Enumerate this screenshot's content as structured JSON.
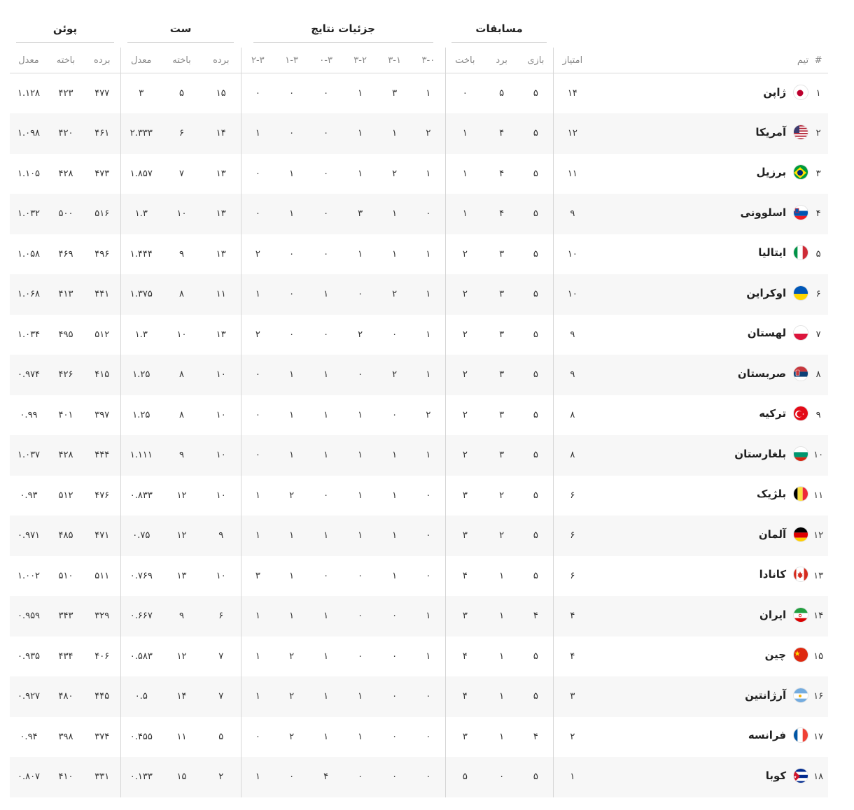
{
  "header": {
    "groups": {
      "matches": "مسابقات",
      "details": "جزئیات نتایج",
      "sets": "ست",
      "points": "پوئن"
    },
    "columns": {
      "rank": "#",
      "team": "تیم",
      "score": "امتیاز",
      "played": "بازی",
      "won": "برد",
      "lost": "باخت",
      "r30": "۳-۰",
      "r31": "۳-۱",
      "r32": "۳-۲",
      "r03": "۰-۳",
      "r13": "۱-۳",
      "r23": "۲-۳",
      "sets_won": "برده",
      "sets_lost": "باخته",
      "sets_ratio": "معدل",
      "pts_won": "برده",
      "pts_lost": "باخته",
      "pts_ratio": "معدل"
    }
  },
  "rows": [
    {
      "rank": "۱",
      "team": "ژاپن",
      "flag": "japan-flag-icon",
      "score": "۱۴",
      "played": "۵",
      "won": "۵",
      "lost": "۰",
      "r30": "۱",
      "r31": "۳",
      "r32": "۱",
      "r03": "۰",
      "r13": "۰",
      "r23": "۰",
      "sets_won": "۱۵",
      "sets_lost": "۵",
      "sets_ratio": "۳",
      "pts_won": "۴۷۷",
      "pts_lost": "۴۲۳",
      "pts_ratio": "۱.۱۲۸"
    },
    {
      "rank": "۲",
      "team": "آمریکا",
      "flag": "usa-flag-icon",
      "score": "۱۲",
      "played": "۵",
      "won": "۴",
      "lost": "۱",
      "r30": "۲",
      "r31": "۱",
      "r32": "۱",
      "r03": "۰",
      "r13": "۰",
      "r23": "۱",
      "sets_won": "۱۴",
      "sets_lost": "۶",
      "sets_ratio": "۲.۳۳۳",
      "pts_won": "۴۶۱",
      "pts_lost": "۴۲۰",
      "pts_ratio": "۱.۰۹۸"
    },
    {
      "rank": "۳",
      "team": "برزیل",
      "flag": "brazil-flag-icon",
      "score": "۱۱",
      "played": "۵",
      "won": "۴",
      "lost": "۱",
      "r30": "۱",
      "r31": "۲",
      "r32": "۱",
      "r03": "۰",
      "r13": "۱",
      "r23": "۰",
      "sets_won": "۱۳",
      "sets_lost": "۷",
      "sets_ratio": "۱.۸۵۷",
      "pts_won": "۴۷۳",
      "pts_lost": "۴۲۸",
      "pts_ratio": "۱.۱۰۵"
    },
    {
      "rank": "۴",
      "team": "اسلوونی",
      "flag": "slovenia-flag-icon",
      "score": "۹",
      "played": "۵",
      "won": "۴",
      "lost": "۱",
      "r30": "۰",
      "r31": "۱",
      "r32": "۳",
      "r03": "۰",
      "r13": "۱",
      "r23": "۰",
      "sets_won": "۱۳",
      "sets_lost": "۱۰",
      "sets_ratio": "۱.۳",
      "pts_won": "۵۱۶",
      "pts_lost": "۵۰۰",
      "pts_ratio": "۱.۰۳۲"
    },
    {
      "rank": "۵",
      "team": "ایتالیا",
      "flag": "italy-flag-icon",
      "score": "۱۰",
      "played": "۵",
      "won": "۳",
      "lost": "۲",
      "r30": "۱",
      "r31": "۱",
      "r32": "۱",
      "r03": "۰",
      "r13": "۰",
      "r23": "۲",
      "sets_won": "۱۳",
      "sets_lost": "۹",
      "sets_ratio": "۱.۴۴۴",
      "pts_won": "۴۹۶",
      "pts_lost": "۴۶۹",
      "pts_ratio": "۱.۰۵۸"
    },
    {
      "rank": "۶",
      "team": "اوکراین",
      "flag": "ukraine-flag-icon",
      "score": "۱۰",
      "played": "۵",
      "won": "۳",
      "lost": "۲",
      "r30": "۱",
      "r31": "۲",
      "r32": "۰",
      "r03": "۱",
      "r13": "۰",
      "r23": "۱",
      "sets_won": "۱۱",
      "sets_lost": "۸",
      "sets_ratio": "۱.۳۷۵",
      "pts_won": "۴۴۱",
      "pts_lost": "۴۱۳",
      "pts_ratio": "۱.۰۶۸"
    },
    {
      "rank": "۷",
      "team": "لهستان",
      "flag": "poland-flag-icon",
      "score": "۹",
      "played": "۵",
      "won": "۳",
      "lost": "۲",
      "r30": "۱",
      "r31": "۰",
      "r32": "۲",
      "r03": "۰",
      "r13": "۰",
      "r23": "۲",
      "sets_won": "۱۳",
      "sets_lost": "۱۰",
      "sets_ratio": "۱.۳",
      "pts_won": "۵۱۲",
      "pts_lost": "۴۹۵",
      "pts_ratio": "۱.۰۳۴"
    },
    {
      "rank": "۸",
      "team": "صربستان",
      "flag": "serbia-flag-icon",
      "score": "۹",
      "played": "۵",
      "won": "۳",
      "lost": "۲",
      "r30": "۱",
      "r31": "۲",
      "r32": "۰",
      "r03": "۱",
      "r13": "۱",
      "r23": "۰",
      "sets_won": "۱۰",
      "sets_lost": "۸",
      "sets_ratio": "۱.۲۵",
      "pts_won": "۴۱۵",
      "pts_lost": "۴۲۶",
      "pts_ratio": "۰.۹۷۴"
    },
    {
      "rank": "۹",
      "team": "ترکیه",
      "flag": "turkey-flag-icon",
      "score": "۸",
      "played": "۵",
      "won": "۳",
      "lost": "۲",
      "r30": "۲",
      "r31": "۰",
      "r32": "۱",
      "r03": "۱",
      "r13": "۱",
      "r23": "۰",
      "sets_won": "۱۰",
      "sets_lost": "۸",
      "sets_ratio": "۱.۲۵",
      "pts_won": "۳۹۷",
      "pts_lost": "۴۰۱",
      "pts_ratio": "۰.۹۹"
    },
    {
      "rank": "۱۰",
      "team": "بلغارستان",
      "flag": "bulgaria-flag-icon",
      "score": "۸",
      "played": "۵",
      "won": "۳",
      "lost": "۲",
      "r30": "۱",
      "r31": "۱",
      "r32": "۱",
      "r03": "۱",
      "r13": "۱",
      "r23": "۰",
      "sets_won": "۱۰",
      "sets_lost": "۹",
      "sets_ratio": "۱.۱۱۱",
      "pts_won": "۴۴۴",
      "pts_lost": "۴۲۸",
      "pts_ratio": "۱.۰۳۷"
    },
    {
      "rank": "۱۱",
      "team": "بلژیک",
      "flag": "belgium-flag-icon",
      "score": "۶",
      "played": "۵",
      "won": "۲",
      "lost": "۳",
      "r30": "۰",
      "r31": "۱",
      "r32": "۱",
      "r03": "۰",
      "r13": "۲",
      "r23": "۱",
      "sets_won": "۱۰",
      "sets_lost": "۱۲",
      "sets_ratio": "۰.۸۳۳",
      "pts_won": "۴۷۶",
      "pts_lost": "۵۱۲",
      "pts_ratio": "۰.۹۳"
    },
    {
      "rank": "۱۲",
      "team": "آلمان",
      "flag": "germany-flag-icon",
      "score": "۶",
      "played": "۵",
      "won": "۲",
      "lost": "۳",
      "r30": "۰",
      "r31": "۱",
      "r32": "۱",
      "r03": "۱",
      "r13": "۱",
      "r23": "۱",
      "sets_won": "۹",
      "sets_lost": "۱۲",
      "sets_ratio": "۰.۷۵",
      "pts_won": "۴۷۱",
      "pts_lost": "۴۸۵",
      "pts_ratio": "۰.۹۷۱"
    },
    {
      "rank": "۱۳",
      "team": "کانادا",
      "flag": "canada-flag-icon",
      "score": "۶",
      "played": "۵",
      "won": "۱",
      "lost": "۴",
      "r30": "۰",
      "r31": "۱",
      "r32": "۰",
      "r03": "۰",
      "r13": "۱",
      "r23": "۳",
      "sets_won": "۱۰",
      "sets_lost": "۱۳",
      "sets_ratio": "۰.۷۶۹",
      "pts_won": "۵۱۱",
      "pts_lost": "۵۱۰",
      "pts_ratio": "۱.۰۰۲"
    },
    {
      "rank": "۱۴",
      "team": "ایران",
      "flag": "iran-flag-icon",
      "score": "۴",
      "played": "۴",
      "won": "۱",
      "lost": "۳",
      "r30": "۱",
      "r31": "۰",
      "r32": "۰",
      "r03": "۱",
      "r13": "۱",
      "r23": "۱",
      "sets_won": "۶",
      "sets_lost": "۹",
      "sets_ratio": "۰.۶۶۷",
      "pts_won": "۳۲۹",
      "pts_lost": "۳۴۳",
      "pts_ratio": "۰.۹۵۹"
    },
    {
      "rank": "۱۵",
      "team": "چین",
      "flag": "china-flag-icon",
      "score": "۴",
      "played": "۵",
      "won": "۱",
      "lost": "۴",
      "r30": "۱",
      "r31": "۰",
      "r32": "۰",
      "r03": "۱",
      "r13": "۲",
      "r23": "۱",
      "sets_won": "۷",
      "sets_lost": "۱۲",
      "sets_ratio": "۰.۵۸۳",
      "pts_won": "۴۰۶",
      "pts_lost": "۴۳۴",
      "pts_ratio": "۰.۹۳۵"
    },
    {
      "rank": "۱۶",
      "team": "آرژانتین",
      "flag": "argentina-flag-icon",
      "score": "۳",
      "played": "۵",
      "won": "۱",
      "lost": "۴",
      "r30": "۰",
      "r31": "۰",
      "r32": "۱",
      "r03": "۱",
      "r13": "۲",
      "r23": "۱",
      "sets_won": "۷",
      "sets_lost": "۱۴",
      "sets_ratio": "۰.۵",
      "pts_won": "۴۴۵",
      "pts_lost": "۴۸۰",
      "pts_ratio": "۰.۹۲۷"
    },
    {
      "rank": "۱۷",
      "team": "فرانسه",
      "flag": "france-flag-icon",
      "score": "۲",
      "played": "۴",
      "won": "۱",
      "lost": "۳",
      "r30": "۰",
      "r31": "۰",
      "r32": "۱",
      "r03": "۱",
      "r13": "۲",
      "r23": "۰",
      "sets_won": "۵",
      "sets_lost": "۱۱",
      "sets_ratio": "۰.۴۵۵",
      "pts_won": "۳۷۴",
      "pts_lost": "۳۹۸",
      "pts_ratio": "۰.۹۴"
    },
    {
      "rank": "۱۸",
      "team": "کوبا",
      "flag": "cuba-flag-icon",
      "score": "۱",
      "played": "۵",
      "won": "۰",
      "lost": "۵",
      "r30": "۰",
      "r31": "۰",
      "r32": "۰",
      "r03": "۴",
      "r13": "۰",
      "r23": "۱",
      "sets_won": "۲",
      "sets_lost": "۱۵",
      "sets_ratio": "۰.۱۳۳",
      "pts_won": "۳۳۱",
      "pts_lost": "۴۱۰",
      "pts_ratio": "۰.۸۰۷"
    }
  ]
}
